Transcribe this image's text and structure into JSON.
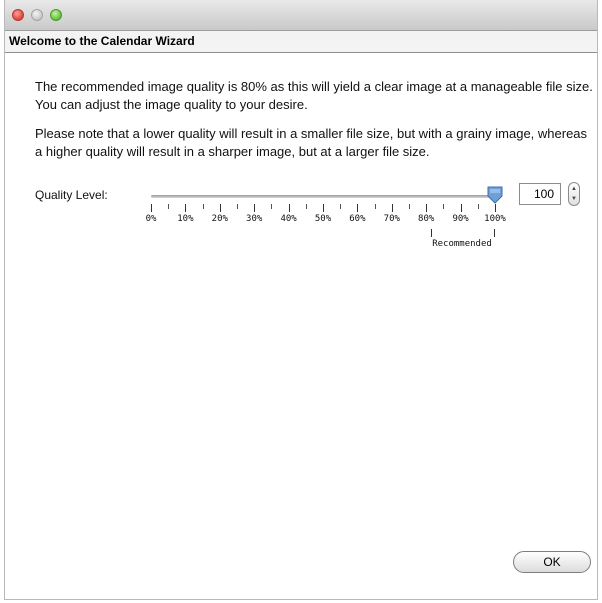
{
  "window": {
    "traffic_lights": [
      "close",
      "minimize",
      "zoom"
    ],
    "close_color": "#e0443a",
    "zoom_color": "#5fbe3a"
  },
  "header": {
    "title": "Welcome to the Calendar Wizard"
  },
  "body": {
    "paragraph1": "The recommended image quality is 80% as this will yield a clear image at a manageable file size. You can adjust the image quality to your desire.",
    "paragraph2": "Please note that a lower quality will result in a smaller file size, but with a grainy image, whereas a higher quality will result in a sharper image, but at a larger file size."
  },
  "quality": {
    "label": "Quality Level:",
    "value": "100",
    "slider_level_percent": 100,
    "tick_labels": [
      "0%",
      "10%",
      "20%",
      "30%",
      "40%",
      "50%",
      "60%",
      "70%",
      "80%",
      "90%",
      "100%"
    ],
    "recommended_label": "Recommended",
    "thumb_color": "#6f9fd8"
  },
  "footer": {
    "ok_label": "OK"
  }
}
